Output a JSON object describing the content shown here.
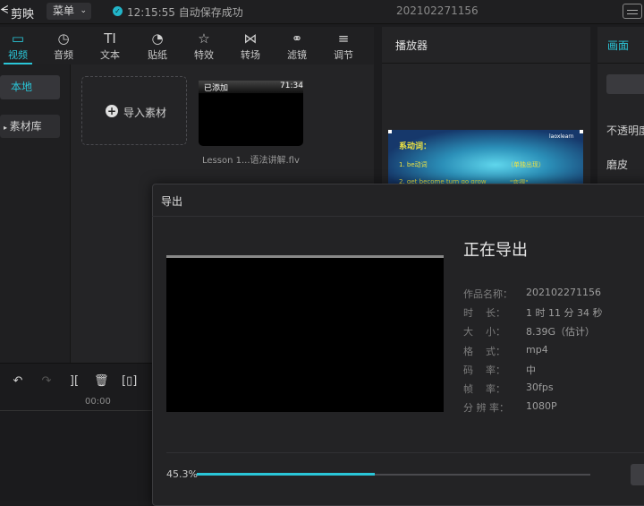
{
  "topbar": {
    "app_name": "剪映",
    "menu_label": "菜单",
    "save_status": "12:15:55 自动保存成功",
    "project_title": "202102271156"
  },
  "tool_tabs": [
    {
      "label": "视频",
      "icon": "video-icon",
      "glyph": "▭",
      "active": true
    },
    {
      "label": "音频",
      "icon": "audio-icon",
      "glyph": "◷"
    },
    {
      "label": "文本",
      "icon": "text-icon",
      "glyph": "TI"
    },
    {
      "label": "贴纸",
      "icon": "sticker-icon",
      "glyph": "◔"
    },
    {
      "label": "特效",
      "icon": "effects-icon",
      "glyph": "☆"
    },
    {
      "label": "转场",
      "icon": "transition-icon",
      "glyph": "⋈"
    },
    {
      "label": "滤镜",
      "icon": "filter-icon",
      "glyph": "⚭"
    },
    {
      "label": "调节",
      "icon": "adjust-icon",
      "glyph": "≡"
    }
  ],
  "side_nav": {
    "local": "本地",
    "library": "素材库"
  },
  "media": {
    "import_label": "导入素材",
    "clip_added": "已添加",
    "clip_duration": "71:34",
    "clip_name": "Lesson 1...语法讲解.flv"
  },
  "timeline": {
    "time": "00:00"
  },
  "player": {
    "title": "播放器",
    "preview": {
      "heading": "系动词：",
      "brand": "laoxlearn",
      "line1": "1. be动词",
      "line1_note": "（单独出现）",
      "line2": "2. get become turn go grow",
      "line2_note": "\"变得\""
    }
  },
  "props": {
    "tab": "画面",
    "opacity": "不透明度",
    "skin": "磨皮"
  },
  "export": {
    "title": "导出",
    "status": "正在导出",
    "info": [
      {
        "label": "作品名称：",
        "value": "202102271156"
      },
      {
        "label": "时    长：",
        "value": "1 时 11 分 34 秒"
      },
      {
        "label": "大    小：",
        "value": "8.39G（估计）"
      },
      {
        "label": "格    式：",
        "value": "mp4"
      },
      {
        "label": "码    率：",
        "value": "中"
      },
      {
        "label": "帧    率：",
        "value": "30fps"
      },
      {
        "label": "分 辨 率：",
        "value": "1080P"
      }
    ],
    "progress_text": "45.3%",
    "progress": 0.453
  },
  "colors": {
    "accent": "#2ac6d8",
    "background": "#1c1c1e"
  }
}
